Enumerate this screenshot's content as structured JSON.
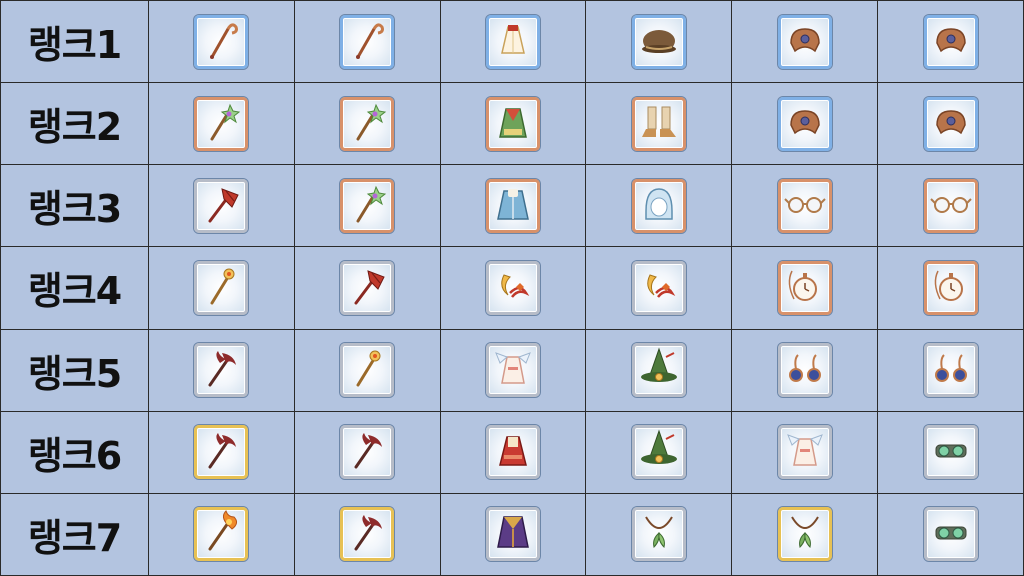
{
  "ranks": [
    "랭크1",
    "랭크2",
    "랭크3",
    "랭크4",
    "랭크5",
    "랭크6",
    "랭크7"
  ],
  "frame_colors": {
    "blue": "#7fb0e6",
    "copper": "#d8916a",
    "silver": "#b6bcc8",
    "gold": "#e7c154"
  },
  "rows": [
    [
      {
        "icon": "crook-staff-icon",
        "frame": "blue"
      },
      {
        "icon": "crook-staff-icon",
        "frame": "blue"
      },
      {
        "icon": "dress-icon",
        "frame": "blue"
      },
      {
        "icon": "cap-icon",
        "frame": "blue"
      },
      {
        "icon": "bracelet-icon",
        "frame": "blue"
      },
      {
        "icon": "bracelet-icon",
        "frame": "blue"
      }
    ],
    [
      {
        "icon": "star-wand-icon",
        "frame": "copper"
      },
      {
        "icon": "star-wand-icon",
        "frame": "copper"
      },
      {
        "icon": "robe-icon",
        "frame": "copper"
      },
      {
        "icon": "boots-icon",
        "frame": "copper"
      },
      {
        "icon": "bracelet-icon",
        "frame": "blue"
      },
      {
        "icon": "bracelet-icon",
        "frame": "blue"
      }
    ],
    [
      {
        "icon": "trident-spear-icon",
        "frame": "silver"
      },
      {
        "icon": "star-wand-icon",
        "frame": "copper"
      },
      {
        "icon": "coat-icon",
        "frame": "copper"
      },
      {
        "icon": "hood-icon",
        "frame": "copper"
      },
      {
        "icon": "glasses-icon",
        "frame": "copper"
      },
      {
        "icon": "glasses-icon",
        "frame": "copper"
      }
    ],
    [
      {
        "icon": "golden-scepter-icon",
        "frame": "silver"
      },
      {
        "icon": "trident-spear-icon",
        "frame": "silver"
      },
      {
        "icon": "moon-charm-icon",
        "frame": "silver"
      },
      {
        "icon": "moon-charm-icon",
        "frame": "silver"
      },
      {
        "icon": "pocket-watch-icon",
        "frame": "copper"
      },
      {
        "icon": "pocket-watch-icon",
        "frame": "copper"
      }
    ],
    [
      {
        "icon": "dark-staff-icon",
        "frame": "silver"
      },
      {
        "icon": "golden-scepter-icon",
        "frame": "silver"
      },
      {
        "icon": "winged-dress-icon",
        "frame": "silver"
      },
      {
        "icon": "witch-hat-icon",
        "frame": "silver"
      },
      {
        "icon": "earrings-icon",
        "frame": "silver"
      },
      {
        "icon": "earrings-icon",
        "frame": "silver"
      }
    ],
    [
      {
        "icon": "dark-staff-icon",
        "frame": "gold"
      },
      {
        "icon": "dark-staff-icon",
        "frame": "silver"
      },
      {
        "icon": "red-dress-icon",
        "frame": "silver"
      },
      {
        "icon": "witch-hat-icon",
        "frame": "silver"
      },
      {
        "icon": "winged-dress-icon",
        "frame": "silver"
      },
      {
        "icon": "goggles-icon",
        "frame": "silver"
      }
    ],
    [
      {
        "icon": "flame-staff-icon",
        "frame": "gold"
      },
      {
        "icon": "dark-staff-icon",
        "frame": "gold"
      },
      {
        "icon": "purple-robe-icon",
        "frame": "silver"
      },
      {
        "icon": "leaf-necklace-icon",
        "frame": "silver"
      },
      {
        "icon": "leaf-necklace-icon",
        "frame": "gold"
      },
      {
        "icon": "goggles-icon",
        "frame": "silver"
      }
    ]
  ]
}
